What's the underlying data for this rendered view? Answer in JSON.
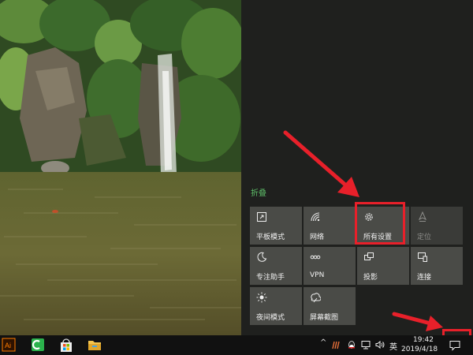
{
  "action_center": {
    "collapse_label": "折叠",
    "tiles": [
      {
        "label": "平板模式",
        "icon": "tablet-mode-icon",
        "enabled": true
      },
      {
        "label": "网络",
        "icon": "network-icon",
        "enabled": true
      },
      {
        "label": "所有设置",
        "icon": "gear-icon",
        "enabled": true,
        "highlighted": true
      },
      {
        "label": "定位",
        "icon": "location-icon",
        "enabled": false
      },
      {
        "label": "专注助手",
        "icon": "moon-icon",
        "enabled": true
      },
      {
        "label": "VPN",
        "icon": "vpn-icon",
        "enabled": true
      },
      {
        "label": "投影",
        "icon": "project-icon",
        "enabled": true
      },
      {
        "label": "连接",
        "icon": "connect-icon",
        "enabled": true
      },
      {
        "label": "夜间模式",
        "icon": "brightness-icon",
        "enabled": true
      },
      {
        "label": "屏幕截图",
        "icon": "screen-snip-icon",
        "enabled": true
      }
    ]
  },
  "taskbar": {
    "apps": [
      {
        "name": "adobe-illustrator",
        "label": "Ai",
        "color": "#ff7c00"
      },
      {
        "name": "camtasia",
        "color": "#2bb24c"
      },
      {
        "name": "microsoft-store",
        "color": "#0078d7"
      },
      {
        "name": "file-explorer",
        "color": "#f4c44e"
      }
    ],
    "tray": {
      "chevron": "^",
      "ime_label": "英",
      "time": "19:42",
      "date": "2019/4/18"
    }
  },
  "annotations": {
    "highlight_color": "#e8202a"
  }
}
